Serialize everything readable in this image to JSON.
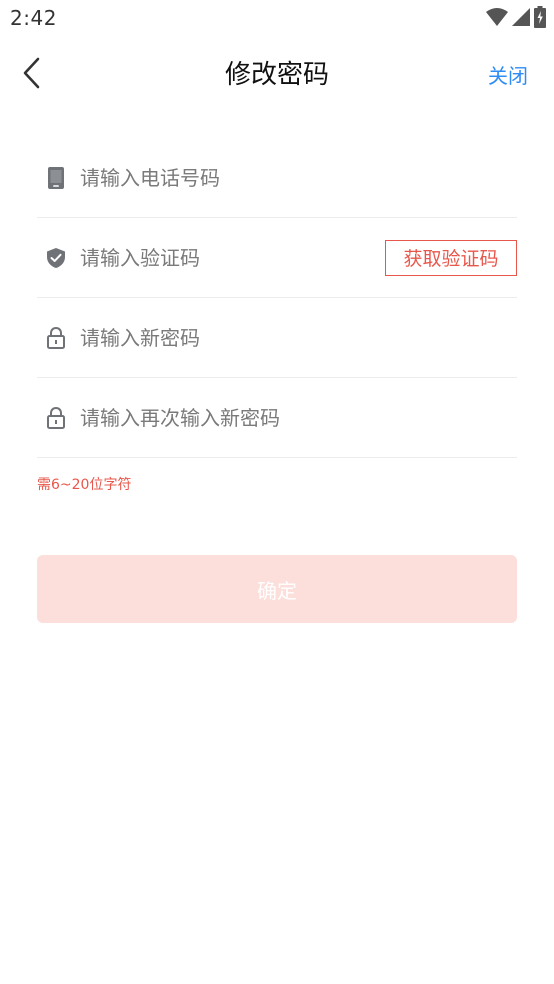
{
  "status_bar": {
    "time": "2:42"
  },
  "nav": {
    "title": "修改密码",
    "close_label": "关闭"
  },
  "form": {
    "phone_placeholder": "请输入电话号码",
    "code_placeholder": "请输入验证码",
    "get_code_label": "获取验证码",
    "new_password_placeholder": "请输入新密码",
    "confirm_password_placeholder": "请输入再次输入新密码",
    "hint": "需6~20位字符"
  },
  "submit": {
    "label": "确定"
  },
  "colors": {
    "accent_blue": "#2f8cf5",
    "accent_red": "#e8574c",
    "button_disabled_bg": "#fcdedb"
  }
}
